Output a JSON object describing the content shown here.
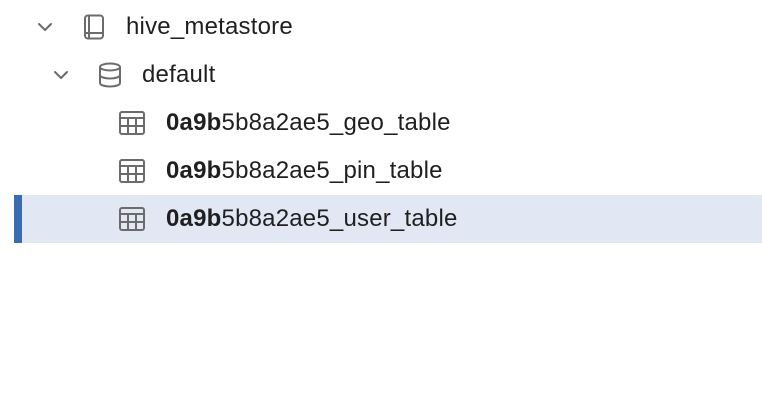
{
  "tree": {
    "catalog": {
      "label": "hive_metastore",
      "icon": "book-icon",
      "expanded": true
    },
    "schema": {
      "label": "default",
      "icon": "database-icon",
      "expanded": true
    },
    "tables": [
      {
        "match": "0a9b",
        "rest": "5b8a2ae5_geo_table",
        "icon": "table-icon",
        "selected": false
      },
      {
        "match": "0a9b",
        "rest": "5b8a2ae5_pin_table",
        "icon": "table-icon",
        "selected": false
      },
      {
        "match": "0a9b",
        "rest": "5b8a2ae5_user_table",
        "icon": "table-icon",
        "selected": true
      }
    ]
  },
  "colors": {
    "selection_background": "#e1e8f3",
    "selection_bar": "#3a6db0",
    "icon_gray": "#6b6b6b",
    "text": "#1f1f1f"
  }
}
